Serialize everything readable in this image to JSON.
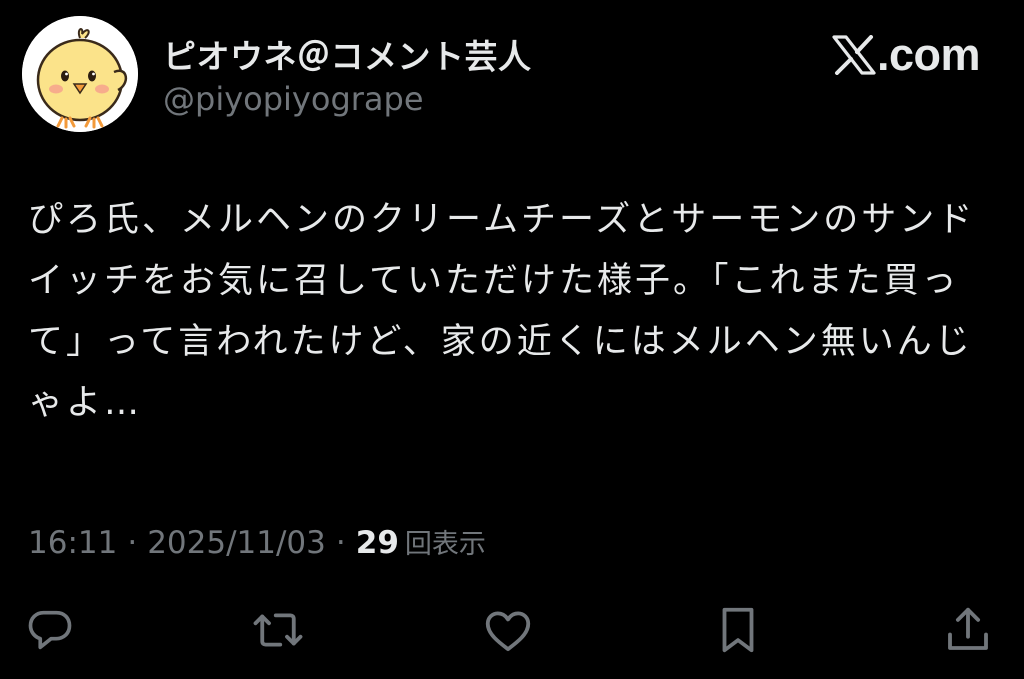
{
  "author": {
    "display_name": "ピオウネ＠コメント芸人",
    "handle": "@piyopiyogrape",
    "avatar": "chick-avatar"
  },
  "site": {
    "label": ".com",
    "logo": "x-logo"
  },
  "tweet": {
    "text": "ぴろ氏、メルヘンのクリームチーズとサーモンのサンドイッチをお気に召していただけた様子。「これまた買って」って言われたけど、家の近くにはメルヘン無いんじゃよ…"
  },
  "meta": {
    "time": "16:11",
    "separator": "·",
    "date": "2025/11/03",
    "views_count": "29",
    "views_label": "回表示"
  },
  "actions": [
    {
      "name": "reply",
      "icon": "reply-icon"
    },
    {
      "name": "repost",
      "icon": "repost-icon"
    },
    {
      "name": "like",
      "icon": "like-icon"
    },
    {
      "name": "bookmark",
      "icon": "bookmark-icon"
    },
    {
      "name": "share",
      "icon": "share-icon"
    }
  ],
  "colors": {
    "background": "#000000",
    "text_primary": "#e7e9ea",
    "text_secondary": "#71767b",
    "avatar_chick": "#fbe38a"
  }
}
